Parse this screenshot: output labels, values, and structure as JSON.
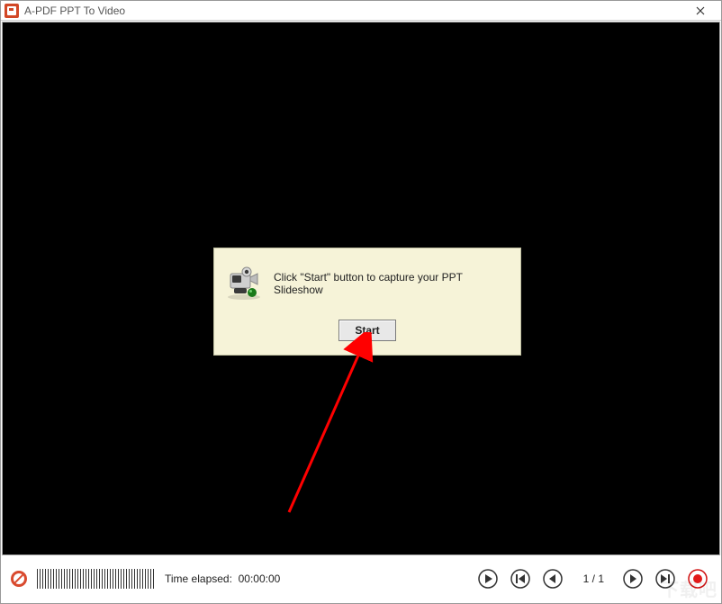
{
  "window": {
    "title": "A-PDF PPT To Video"
  },
  "dialog": {
    "message": "Click \"Start\" button to capture your PPT Slideshow",
    "start_label": "Start"
  },
  "status": {
    "time_label": "Time elapsed:",
    "time_value": "00:00:00",
    "page_count": "1 / 1"
  },
  "icons": {
    "close": "close",
    "camera": "camcorder",
    "record_badge": "record-disabled",
    "play": "play",
    "first": "first",
    "prev": "prev",
    "next": "next",
    "last": "last",
    "record": "record"
  }
}
